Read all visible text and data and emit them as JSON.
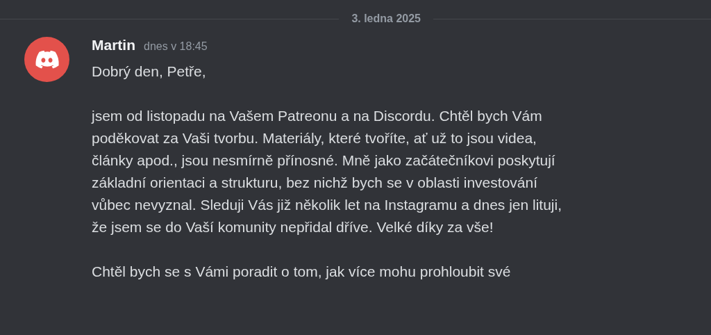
{
  "date_divider": "3. ledna 2025",
  "message": {
    "author": "Martin",
    "timestamp": "dnes v 18:45",
    "paragraphs": [
      {
        "lines": [
          "Dobrý den, Petře,"
        ]
      },
      {
        "lines": [
          "jsem od listopadu na Vašem Patreonu a na Discordu. Chtěl bych Vám",
          "poděkovat za Vaši tvorbu. Materiály, které tvoříte, ať už to jsou videa,",
          "články apod., jsou nesmírně přínosné. Mně jako začátečníkovi poskytují",
          "základní orientaci a strukturu, bez nichž bych se v oblasti investování",
          "vůbec nevyznal. Sleduji Vás již několik let na Instagramu a dnes jen lituji,",
          "že jsem se do Vaší komunity nepřidal dříve. Velké díky za vše!"
        ]
      },
      {
        "lines": [
          "Chtěl bych se s Vámi poradit o tom, jak více mohu prohloubit své"
        ]
      }
    ]
  }
}
